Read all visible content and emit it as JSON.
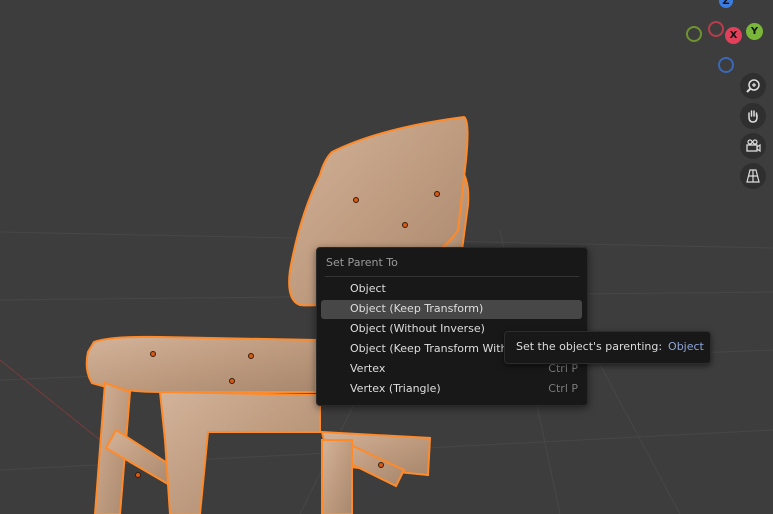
{
  "viewport": {
    "gizmo": {
      "z": "Z",
      "x": "X",
      "y": "Y"
    },
    "nav_buttons": [
      "zoom-icon",
      "hand-pan-icon",
      "camera-icon",
      "grid-perspective-icon"
    ]
  },
  "menu": {
    "title": "Set Parent To",
    "items": [
      {
        "label": "Object",
        "shortcut": ""
      },
      {
        "label": "Object (Keep Transform)",
        "shortcut": ""
      },
      {
        "label": "Object (Without Inverse)",
        "shortcut": ""
      },
      {
        "label": "Object (Keep Transform Witho",
        "shortcut": ""
      },
      {
        "label": "Vertex",
        "shortcut": "Ctrl P"
      },
      {
        "label": "Vertex (Triangle)",
        "shortcut": "Ctrl P"
      }
    ]
  },
  "tooltip": {
    "text": "Set the object's parenting:",
    "value": "Object"
  },
  "colors": {
    "selection_outline": "#ff8a2a",
    "wood": "#c4a184",
    "menu_bg": "#181818",
    "highlight": "#474747"
  }
}
